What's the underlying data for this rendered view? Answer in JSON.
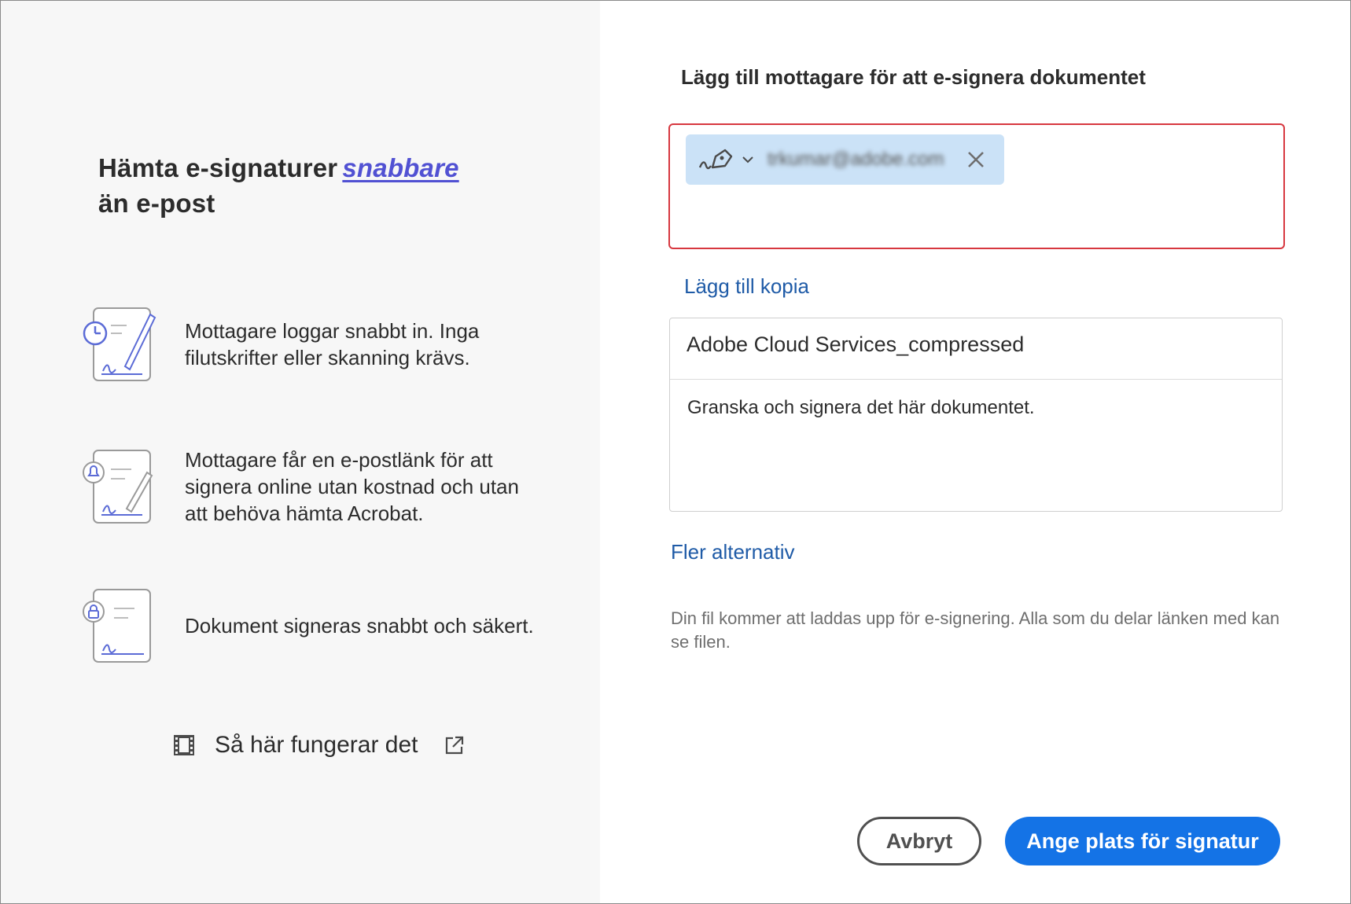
{
  "left": {
    "headline": {
      "before": "Hämta e-signaturer",
      "emphasis": "snabbare",
      "after": "än e-post"
    },
    "features": [
      {
        "icon": "clock-pen-document-icon",
        "text": "Mottagare loggar snabbt in. Inga filutskrifter eller skanning krävs."
      },
      {
        "icon": "bell-pen-document-icon",
        "text": "Mottagare får en e-postlänk för att signera online utan kostnad och utan att behöva hämta Acrobat."
      },
      {
        "icon": "lock-signature-document-icon",
        "text": "Dokument signeras snabbt och säkert."
      }
    ],
    "how_it_works": {
      "label": "Så här fungerar det",
      "icon": "film-icon",
      "link_icon": "external-link-icon"
    }
  },
  "right": {
    "title": "Lägg till mottagare för att e-signera dokumentet",
    "recipient": {
      "email": "trkumar@adobe.com",
      "role_icon": "signer-pen-icon",
      "remove_icon": "close-icon",
      "border_color": "#d7373f"
    },
    "add_cc_label": "Lägg till kopia",
    "document_name": "Adobe Cloud Services_compressed",
    "message": "Granska och signera det här dokumentet.",
    "more_options_label": "Fler alternativ",
    "note": "Din fil kommer att laddas upp för e-signering. Alla som du delar länken med kan se filen.",
    "buttons": {
      "cancel": "Avbryt",
      "primary": "Ange plats för signatur"
    },
    "accent_color": "#1473e6"
  }
}
